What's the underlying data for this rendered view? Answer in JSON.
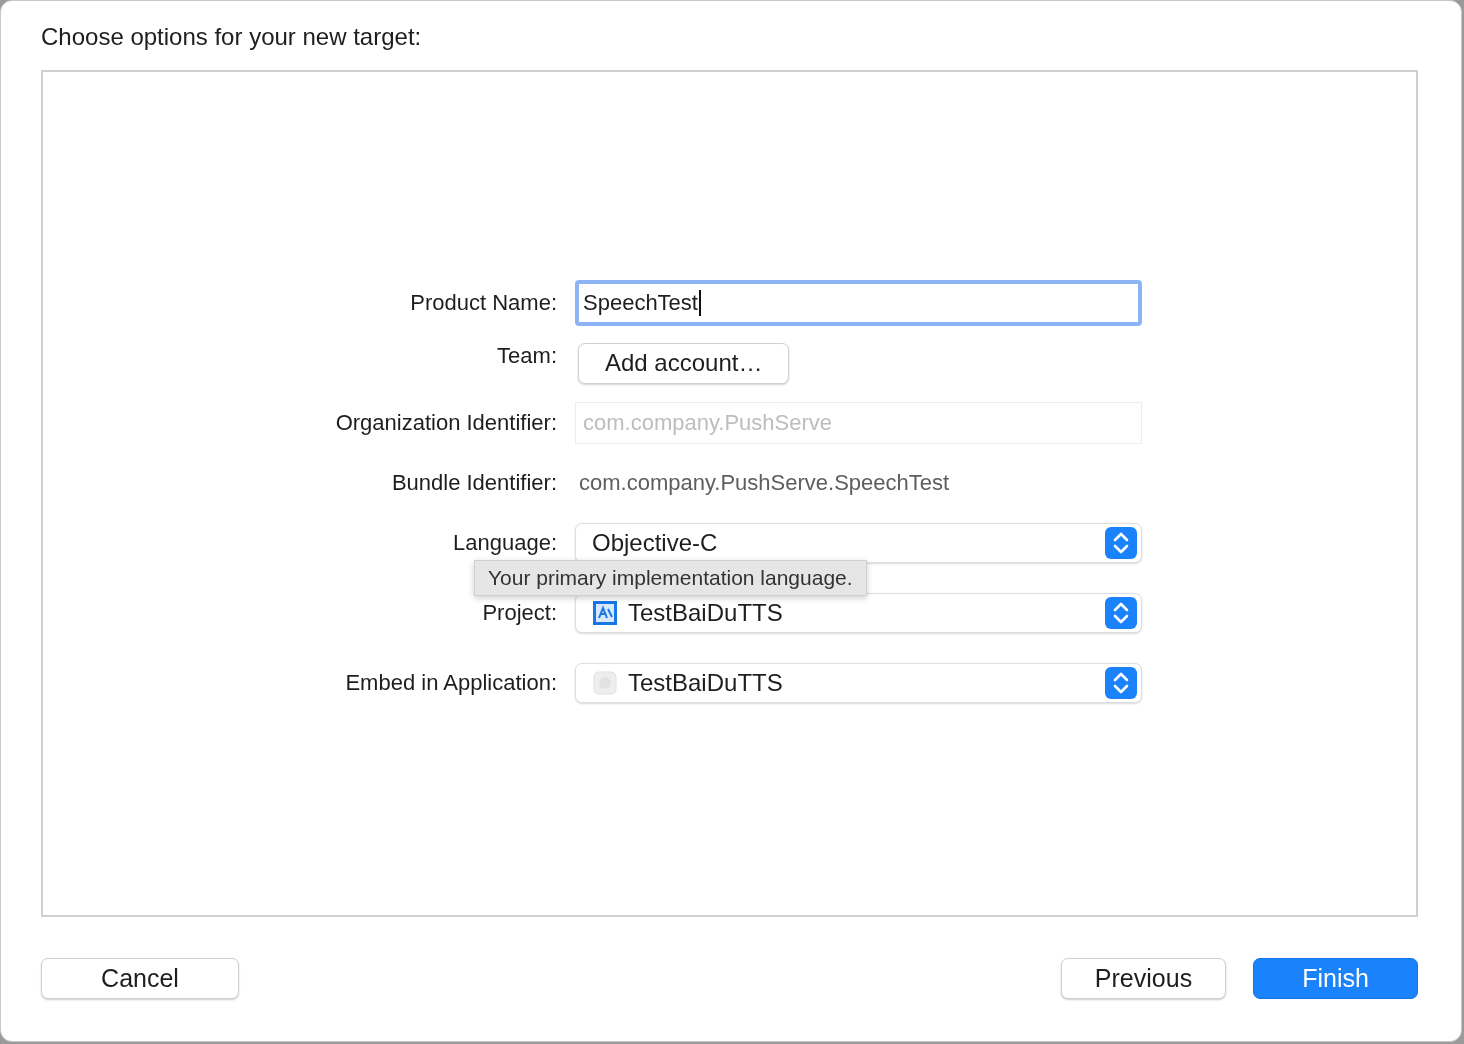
{
  "window": {
    "title": "Choose options for your new target:"
  },
  "form": {
    "fields": [
      {
        "kind": "text",
        "label": "Product Name:",
        "value": "SpeechTest",
        "focused": true
      },
      {
        "kind": "button",
        "label": "Team:",
        "value": "Add account…"
      },
      {
        "kind": "text",
        "label": "Organization Identifier:",
        "placeholder": "com.company.PushServe",
        "focused": false
      },
      {
        "kind": "static",
        "label": "Bundle Identifier:",
        "value": "com.company.PushServe.SpeechTest"
      },
      {
        "kind": "popup",
        "label": "Language:",
        "value": "Objective-C"
      },
      {
        "kind": "project_popup",
        "label": "Project:",
        "value": "TestBaiDuTTS"
      },
      {
        "kind": "app_popup",
        "label": "Embed in Application:",
        "value": "TestBaiDuTTS"
      }
    ]
  },
  "tooltip": "Your primary implementation language.",
  "buttons": [
    {
      "label": "Cancel",
      "kind": "secondary"
    },
    {
      "label": "Previous",
      "kind": "secondary"
    },
    {
      "label": "Finish",
      "kind": "primary"
    }
  ]
}
